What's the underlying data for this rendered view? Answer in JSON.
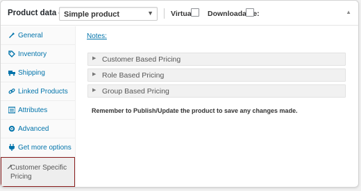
{
  "header": {
    "title": "Product data —",
    "product_type": "Simple product",
    "virtual_label": "Virtual:",
    "downloadable_label": "Downloadable:"
  },
  "sidebar": {
    "items": [
      {
        "label": "General",
        "icon": "wrench-icon"
      },
      {
        "label": "Inventory",
        "icon": "tag-icon"
      },
      {
        "label": "Shipping",
        "icon": "truck-icon"
      },
      {
        "label": "Linked Products",
        "icon": "link-icon"
      },
      {
        "label": "Attributes",
        "icon": "list-icon"
      },
      {
        "label": "Advanced",
        "icon": "gear-icon"
      },
      {
        "label": "Get more options",
        "icon": "plugin-icon"
      },
      {
        "label": "Customer Specific Pricing",
        "icon": "wrench-icon",
        "active": true
      }
    ]
  },
  "main": {
    "notes_link": "Notes:",
    "accordions": [
      {
        "label": "Customer Based Pricing"
      },
      {
        "label": "Role Based Pricing"
      },
      {
        "label": "Group Based Pricing"
      }
    ],
    "hint": "Remember to Publish/Update the product to save any changes made."
  },
  "colors": {
    "link": "#0073aa",
    "active_border": "#8a1d1d"
  }
}
